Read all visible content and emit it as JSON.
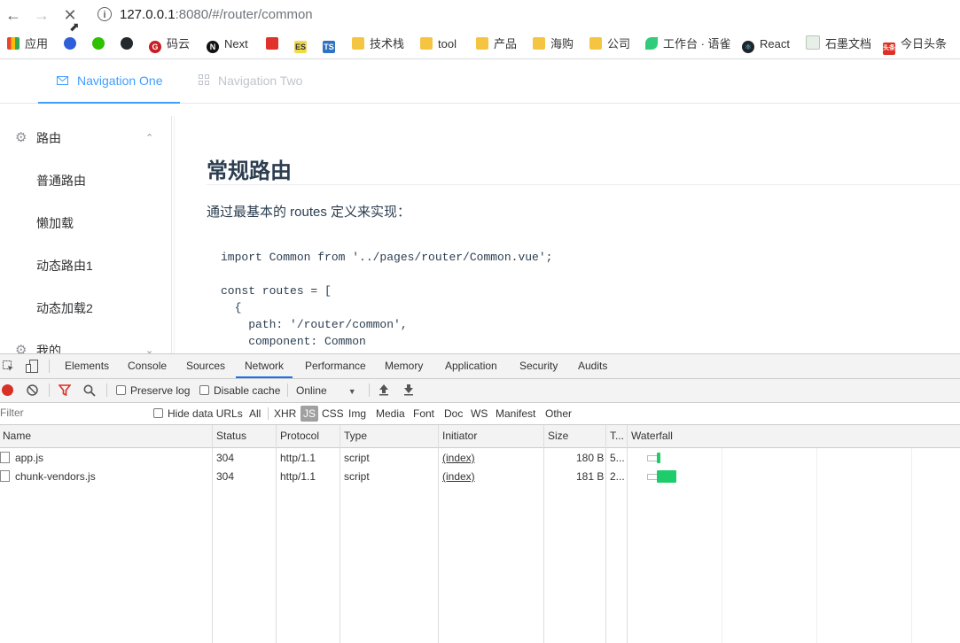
{
  "browser": {
    "url_host": "127.0.0.1",
    "url_rest": ":8080/#/router/common",
    "bookmarks": [
      {
        "label": "应用",
        "icon": "apps-grid-icon"
      },
      {
        "label": "",
        "icon": "baidu-icon"
      },
      {
        "label": "",
        "icon": "wechat-icon"
      },
      {
        "label": "",
        "icon": "github-icon"
      },
      {
        "label": "码云",
        "icon": "gitee-icon"
      },
      {
        "label": "Next",
        "icon": "next-icon"
      },
      {
        "label": "",
        "icon": "red-square-icon"
      },
      {
        "label": "",
        "icon": "es-icon"
      },
      {
        "label": "",
        "icon": "ts-icon"
      },
      {
        "label": "技术栈",
        "icon": "folder-icon"
      },
      {
        "label": "tool",
        "icon": "folder-icon"
      },
      {
        "label": "产品",
        "icon": "folder-icon"
      },
      {
        "label": "海购",
        "icon": "folder-icon"
      },
      {
        "label": "公司",
        "icon": "folder-icon"
      },
      {
        "label": "工作台 · 语雀",
        "icon": "yuque-icon"
      },
      {
        "label": "React",
        "icon": "react-icon"
      },
      {
        "label": "石墨文档",
        "icon": "shimo-icon"
      },
      {
        "label": "今日头条",
        "icon": "toutiao-icon"
      }
    ]
  },
  "app": {
    "nav_tabs": [
      "Navigation One",
      "Navigation Two"
    ],
    "sidebar": {
      "group1": "路由",
      "items": [
        "普通路由",
        "懒加载",
        "动态路由1",
        "动态加载2"
      ],
      "group2": "我的"
    },
    "content": {
      "title": "常规路由",
      "intro": "通过最基本的 routes 定义来实现：",
      "code": "import Common from '../pages/router/Common.vue';\n\nconst routes = [\n  {\n    path: '/router/common',\n    component: Common"
    }
  },
  "devtools": {
    "tabs": [
      "Elements",
      "Console",
      "Sources",
      "Network",
      "Performance",
      "Memory",
      "Application",
      "Security",
      "Audits"
    ],
    "active_tab": "Network",
    "toolbar": {
      "preserve_log": "Preserve log",
      "disable_cache": "Disable cache",
      "throttle": "Online"
    },
    "filter": {
      "placeholder": "Filter",
      "hide_data_urls": "Hide data URLs",
      "types": [
        "All",
        "XHR",
        "JS",
        "CSS",
        "Img",
        "Media",
        "Font",
        "Doc",
        "WS",
        "Manifest",
        "Other"
      ],
      "active_type": "JS"
    },
    "columns": [
      "Name",
      "Status",
      "Protocol",
      "Type",
      "Initiator",
      "Size",
      "T...",
      "Waterfall"
    ],
    "rows": [
      {
        "name": "app.js",
        "status": "304",
        "protocol": "http/1.1",
        "type": "script",
        "initiator": "(index)",
        "size": "180 B",
        "time": "5..."
      },
      {
        "name": "chunk-vendors.js",
        "status": "304",
        "protocol": "http/1.1",
        "type": "script",
        "initiator": "(index)",
        "size": "181 B",
        "time": "2..."
      }
    ],
    "colors": {
      "accent": "#1a73e8",
      "record": "#d93025",
      "download_bar": "#1ecc6b"
    }
  }
}
